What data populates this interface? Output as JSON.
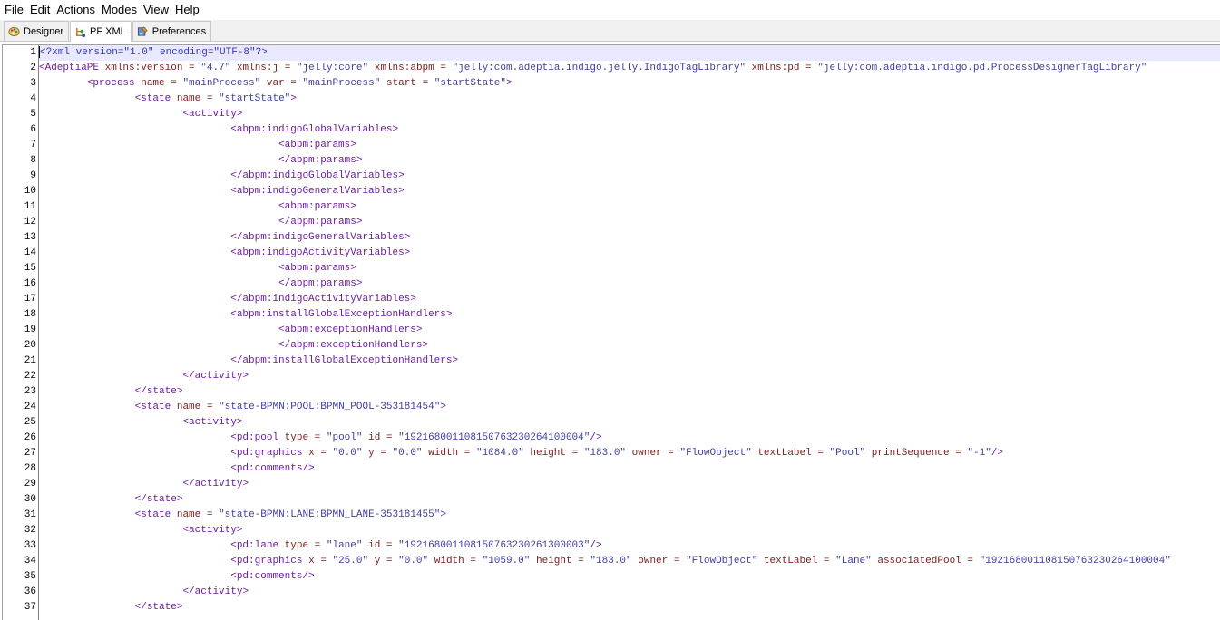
{
  "menubar": {
    "items": [
      "File",
      "Edit",
      "Actions",
      "Modes",
      "View",
      "Help"
    ]
  },
  "tabs": [
    {
      "label": "Designer",
      "icon": "designer-palette-icon",
      "active": false
    },
    {
      "label": "PF XML",
      "icon": "xml-tree-icon",
      "active": true
    },
    {
      "label": "Preferences",
      "icon": "preferences-wrench-icon",
      "active": false
    }
  ],
  "editor": {
    "current_line": 1,
    "lines": [
      "<?xml version=\"1.0\" encoding=\"UTF-8\"?>",
      "<AdeptiaPE xmlns:version = \"4.7\" xmlns:j = \"jelly:core\" xmlns:abpm = \"jelly:com.adeptia.indigo.jelly.IndigoTagLibrary\" xmlns:pd = \"jelly:com.adeptia.indigo.pd.ProcessDesignerTagLibrary\"",
      "\t<process name = \"mainProcess\" var = \"mainProcess\" start = \"startState\">",
      "\t\t<state name = \"startState\">",
      "\t\t\t<activity>",
      "\t\t\t\t<abpm:indigoGlobalVariables>",
      "\t\t\t\t\t<abpm:params>",
      "\t\t\t\t\t</abpm:params>",
      "\t\t\t\t</abpm:indigoGlobalVariables>",
      "\t\t\t\t<abpm:indigoGeneralVariables>",
      "\t\t\t\t\t<abpm:params>",
      "\t\t\t\t\t</abpm:params>",
      "\t\t\t\t</abpm:indigoGeneralVariables>",
      "\t\t\t\t<abpm:indigoActivityVariables>",
      "\t\t\t\t\t<abpm:params>",
      "\t\t\t\t\t</abpm:params>",
      "\t\t\t\t</abpm:indigoActivityVariables>",
      "\t\t\t\t<abpm:installGlobalExceptionHandlers>",
      "\t\t\t\t\t<abpm:exceptionHandlers>",
      "\t\t\t\t\t</abpm:exceptionHandlers>",
      "\t\t\t\t</abpm:installGlobalExceptionHandlers>",
      "\t\t\t</activity>",
      "\t\t</state>",
      "\t\t<state name = \"state-BPMN:POOL:BPMN_POOL-353181454\">",
      "\t\t\t<activity>",
      "\t\t\t\t<pd:pool type = \"pool\" id = \"192168001108150763230264100004\"/>",
      "\t\t\t\t<pd:graphics x = \"0.0\" y = \"0.0\" width = \"1084.0\" height = \"183.0\" owner = \"FlowObject\" textLabel = \"Pool\" printSequence = \"-1\"/>",
      "\t\t\t\t<pd:comments/>",
      "\t\t\t</activity>",
      "\t\t</state>",
      "\t\t<state name = \"state-BPMN:LANE:BPMN_LANE-353181455\">",
      "\t\t\t<activity>",
      "\t\t\t\t<pd:lane type = \"lane\" id = \"192168001108150763230261300003\"/>",
      "\t\t\t\t<pd:graphics x = \"25.0\" y = \"0.0\" width = \"1059.0\" height = \"183.0\" owner = \"FlowObject\" textLabel = \"Lane\" associatedPool = \"192168001108150763230264100004\"",
      "\t\t\t\t<pd:comments/>",
      "\t\t\t</activity>",
      "\t\t</state>"
    ]
  },
  "colors": {
    "tag": "#6b1ca0",
    "attribute": "#7a2020",
    "string": "#4040a0",
    "current_line": "#e8e8ff"
  }
}
